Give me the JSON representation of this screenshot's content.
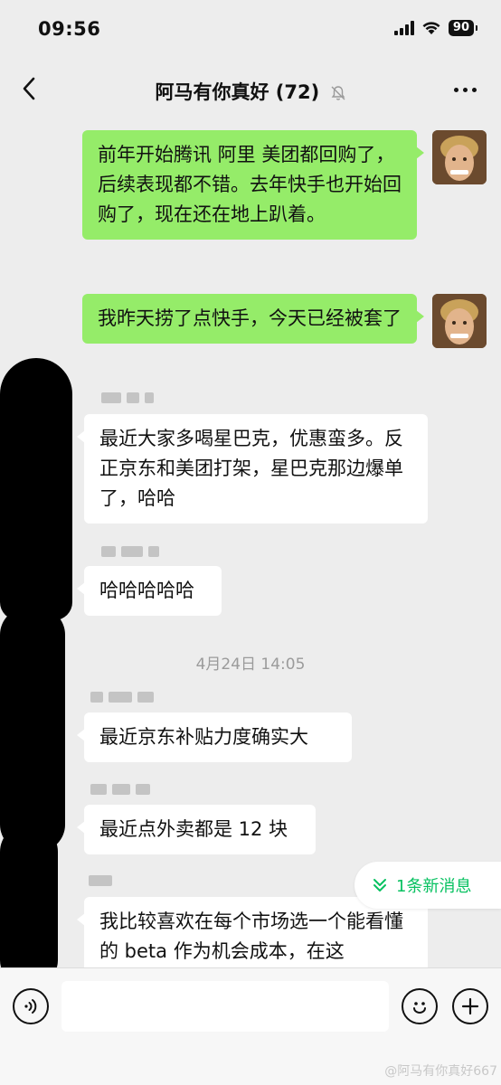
{
  "status": {
    "time": "09:56",
    "battery": "90"
  },
  "nav": {
    "title": "阿马有你真好 (72)",
    "muted": true
  },
  "messages": [
    {
      "side": "me",
      "text": "前年开始腾讯 阿里 美团都回购了，后续表现都不错。去年快手也开始回购了，现在还在地上趴着。"
    },
    {
      "side": "me",
      "text": "我昨天捞了点快手，今天已经被套了"
    },
    {
      "side": "other",
      "text": "最近大家多喝星巴克，优惠蛮多。反正京东和美团打架，星巴克那边爆单了，哈哈"
    },
    {
      "side": "other",
      "text": "哈哈哈哈哈"
    },
    {
      "side": "other",
      "text": "最近京东补贴力度确实大"
    },
    {
      "side": "other",
      "text": "最近点外卖都是 12 块"
    },
    {
      "side": "other",
      "text": "我比较喜欢在每个市场选一个能看懂的 beta 作为机会成本，在这"
    }
  ],
  "timestamp": "4月24日 14:05",
  "new_messages": "1条新消息",
  "input": {
    "placeholder": ""
  },
  "watermark": "@阿马有你真好667",
  "colors": {
    "background": "#ededed",
    "my_bubble": "#95ec69",
    "other_bubble": "#ffffff",
    "accent": "#07c160"
  }
}
